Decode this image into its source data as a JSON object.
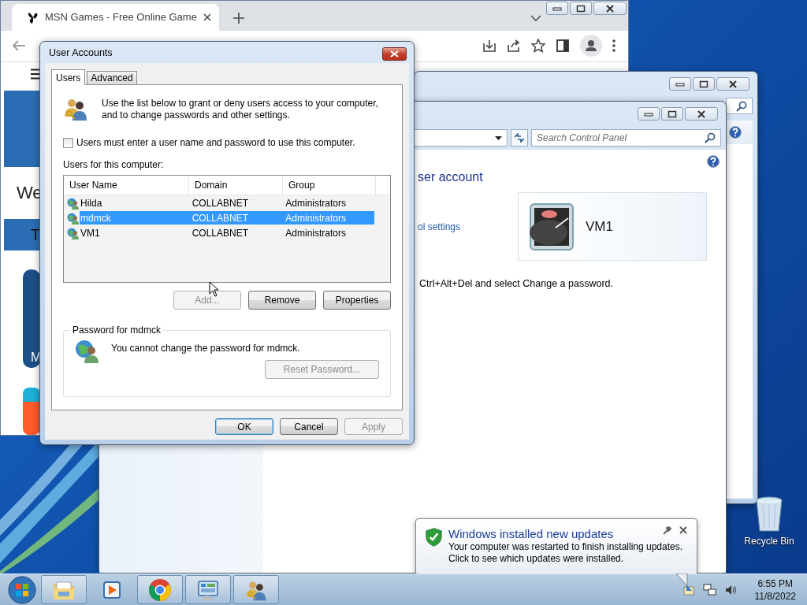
{
  "browser": {
    "tab": {
      "title": "MSN Games - Free Online Game"
    },
    "page": {
      "heading": "We",
      "banner_text": "T",
      "card_text": "M"
    }
  },
  "control_panel": {
    "search": {
      "placeholder": "Search Control Panel"
    },
    "heading": "ser account",
    "link": "ol settings",
    "account": {
      "name": "VM1"
    },
    "note": "Ctrl+Alt+Del and select Change a password."
  },
  "dialog": {
    "title": "User Accounts",
    "tabs": [
      {
        "label": "Users",
        "selected": true
      },
      {
        "label": "Advanced",
        "selected": false
      }
    ],
    "intro": "Use the list below to grant or deny users access to your computer, and to change passwords and other settings.",
    "login_required": {
      "label": "Users must enter a user name and password to use this computer.",
      "checked": false
    },
    "list_label": "Users for this computer:",
    "columns": [
      "User Name",
      "Domain",
      "Group"
    ],
    "rows": [
      {
        "name": "Hilda",
        "domain": "COLLABNET",
        "group": "Administrators",
        "selected": false
      },
      {
        "name": "mdmck",
        "domain": "COLLABNET",
        "group": "Administrators",
        "selected": true
      },
      {
        "name": "VM1",
        "domain": "COLLABNET",
        "group": "Administrators",
        "selected": false
      }
    ],
    "list_buttons": [
      {
        "label": "Add...",
        "disabled": true
      },
      {
        "label": "Remove",
        "disabled": false
      },
      {
        "label": "Properties",
        "disabled": false
      }
    ],
    "password": {
      "title": "Password for mdmck",
      "message": "You cannot change the password for mdmck.",
      "button": {
        "label": "Reset Password...",
        "disabled": true
      }
    },
    "buttons": [
      {
        "label": "OK",
        "default": true,
        "disabled": false
      },
      {
        "label": "Cancel",
        "default": false,
        "disabled": false
      },
      {
        "label": "Apply",
        "default": false,
        "disabled": true
      }
    ]
  },
  "notification": {
    "title": "Windows installed new updates",
    "message": "Your computer was restarted to finish installing updates. Click to see which updates were installed."
  },
  "desktop": {
    "icons": [
      {
        "label": "Recycle Bin"
      }
    ]
  },
  "taskbar": {
    "buttons": [
      {
        "kind": "explorer",
        "running": true
      },
      {
        "kind": "media",
        "running": false
      },
      {
        "kind": "chrome",
        "running": true
      },
      {
        "kind": "control-panel",
        "running": true
      },
      {
        "kind": "users",
        "running": true
      }
    ],
    "clock": {
      "time": "6:55 PM",
      "date": "11/8/2022"
    }
  }
}
